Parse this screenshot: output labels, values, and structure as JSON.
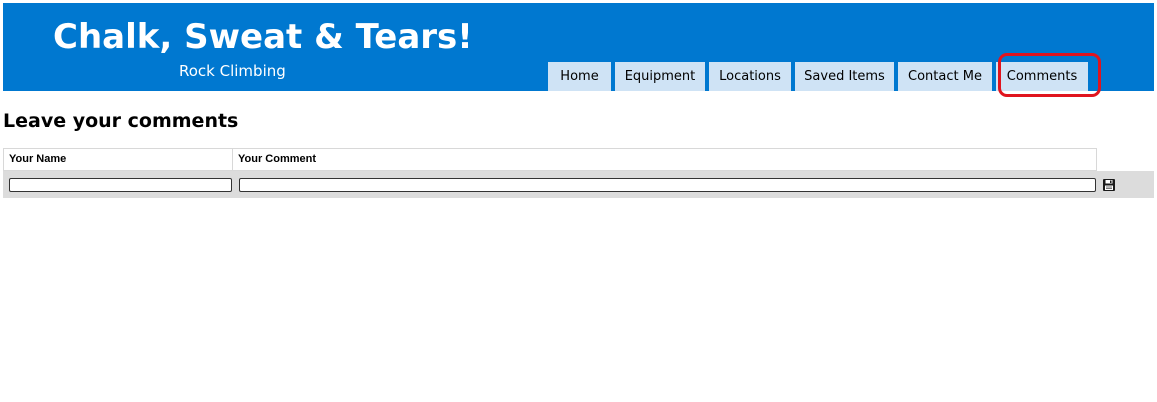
{
  "header": {
    "title": "Chalk, Sweat & Tears!",
    "subtitle": "Rock Climbing",
    "background_color": "#0078d0"
  },
  "nav": {
    "tabs": [
      {
        "label": "Home"
      },
      {
        "label": "Equipment"
      },
      {
        "label": "Locations"
      },
      {
        "label": "Saved Items"
      },
      {
        "label": "Contact Me"
      },
      {
        "label": "Comments",
        "highlighted": true
      }
    ],
    "tab_color": "#cfe3f5",
    "highlight_color": "#e0141e"
  },
  "main": {
    "heading": "Leave your comments",
    "table": {
      "columns": [
        "Your Name",
        "Your Comment"
      ],
      "inputs": {
        "name_value": "",
        "comment_value": ""
      },
      "save_icon": "floppy-disk-icon"
    }
  }
}
